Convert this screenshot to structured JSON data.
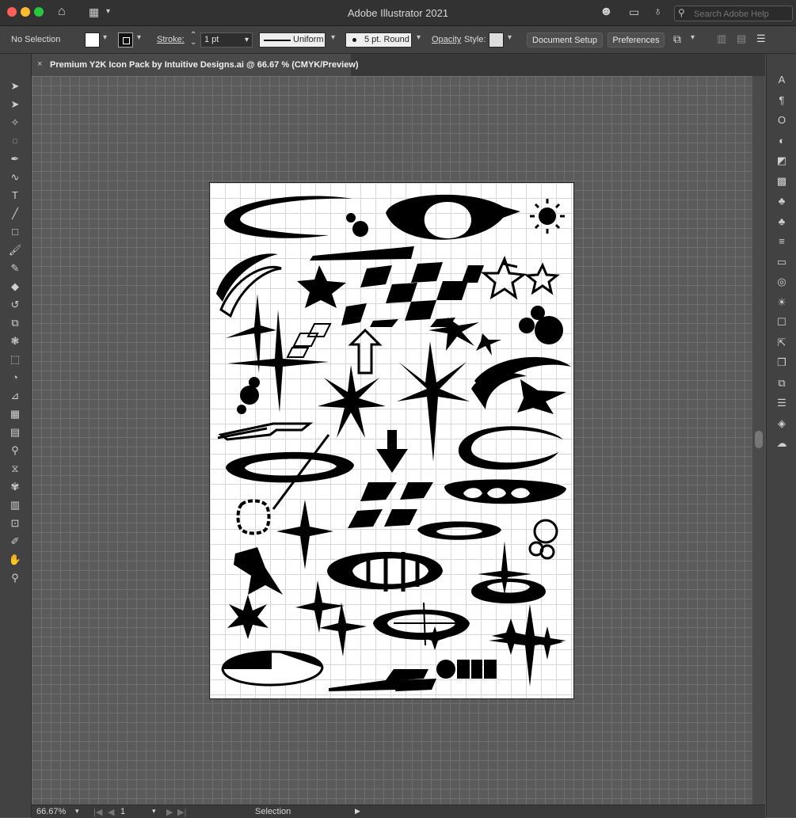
{
  "app": {
    "title": "Adobe Illustrator 2021"
  },
  "search": {
    "placeholder": "Search Adobe Help"
  },
  "control_bar": {
    "selection_label": "No Selection",
    "stroke_label": "Stroke:",
    "stroke_value": "1 pt",
    "profile_label": "Uniform",
    "brush_label": "5 pt. Round",
    "opacity_label": "Opacity",
    "style_label": "Style:",
    "document_setup_label": "Document Setup",
    "preferences_label": "Preferences"
  },
  "document_tab": {
    "close_glyph": "×",
    "title": "Premium Y2K Icon Pack by Intuitive Designs.ai @ 66.67 % (CMYK/Preview)"
  },
  "status_bar": {
    "zoom": "66.67%",
    "artboard_number": "1",
    "tool_name": "Selection"
  },
  "colors": {
    "title_bar": "#323232",
    "panel": "#424242",
    "canvas": "#535353",
    "artboard": "#ffffff",
    "artwork": "#000000"
  },
  "left_tools": [
    {
      "name": "selection-tool-icon",
      "glyph": "➤"
    },
    {
      "name": "direct-selection-tool-icon",
      "glyph": "➤"
    },
    {
      "name": "magic-wand-tool-icon",
      "glyph": "✧"
    },
    {
      "name": "lasso-tool-icon",
      "glyph": "◌"
    },
    {
      "name": "pen-tool-icon",
      "glyph": "✒"
    },
    {
      "name": "curvature-tool-icon",
      "glyph": "∿"
    },
    {
      "name": "type-tool-icon",
      "glyph": "T"
    },
    {
      "name": "line-segment-tool-icon",
      "glyph": "╱"
    },
    {
      "name": "rectangle-tool-icon",
      "glyph": "□"
    },
    {
      "name": "paintbrush-tool-icon",
      "glyph": "🖌"
    },
    {
      "name": "shaper-tool-icon",
      "glyph": "✎"
    },
    {
      "name": "eraser-tool-icon",
      "glyph": "◆"
    },
    {
      "name": "rotate-tool-icon",
      "glyph": "↺"
    },
    {
      "name": "scale-tool-icon",
      "glyph": "⧉"
    },
    {
      "name": "warp-tool-icon",
      "glyph": "❃"
    },
    {
      "name": "free-transform-tool-icon",
      "glyph": "⬚"
    },
    {
      "name": "shape-builder-tool-icon",
      "glyph": "◔"
    },
    {
      "name": "perspective-grid-tool-icon",
      "glyph": "⊿"
    },
    {
      "name": "mesh-tool-icon",
      "glyph": "▦"
    },
    {
      "name": "gradient-tool-icon",
      "glyph": "▤"
    },
    {
      "name": "eyedropper-tool-icon",
      "glyph": "⚲"
    },
    {
      "name": "blend-tool-icon",
      "glyph": "⧖"
    },
    {
      "name": "symbol-sprayer-tool-icon",
      "glyph": "✾"
    },
    {
      "name": "column-graph-tool-icon",
      "glyph": "▥"
    },
    {
      "name": "artboard-tool-icon",
      "glyph": "⊡"
    },
    {
      "name": "slice-tool-icon",
      "glyph": "✐"
    },
    {
      "name": "hand-tool-icon",
      "glyph": "✋"
    },
    {
      "name": "zoom-tool-icon",
      "glyph": "⚲"
    }
  ],
  "right_tools": [
    {
      "name": "character-panel-icon",
      "glyph": "A"
    },
    {
      "name": "paragraph-panel-icon",
      "glyph": "¶"
    },
    {
      "name": "opentype-panel-icon",
      "glyph": "O"
    },
    {
      "name": "color-panel-icon",
      "glyph": "◐"
    },
    {
      "name": "color-guide-panel-icon",
      "glyph": "◩"
    },
    {
      "name": "swatches-panel-icon",
      "glyph": "▩"
    },
    {
      "name": "brushes-panel-icon",
      "glyph": "♣"
    },
    {
      "name": "symbols-panel-icon",
      "glyph": "♣"
    },
    {
      "name": "stroke-panel-icon",
      "glyph": "≡"
    },
    {
      "name": "gradient-panel-icon",
      "glyph": "▭"
    },
    {
      "name": "transparency-panel-icon",
      "glyph": "◎"
    },
    {
      "name": "appearance-panel-icon",
      "glyph": "☀"
    },
    {
      "name": "graphic-styles-panel-icon",
      "glyph": "☐"
    },
    {
      "name": "export-panel-icon",
      "glyph": "⇱"
    },
    {
      "name": "artboards-panel-icon",
      "glyph": "❐"
    },
    {
      "name": "pathfinder-panel-icon",
      "glyph": "⧉"
    },
    {
      "name": "properties-panel-icon",
      "glyph": "☰"
    },
    {
      "name": "layers-panel-icon",
      "glyph": "◈"
    },
    {
      "name": "libraries-panel-icon",
      "glyph": "☁"
    }
  ]
}
